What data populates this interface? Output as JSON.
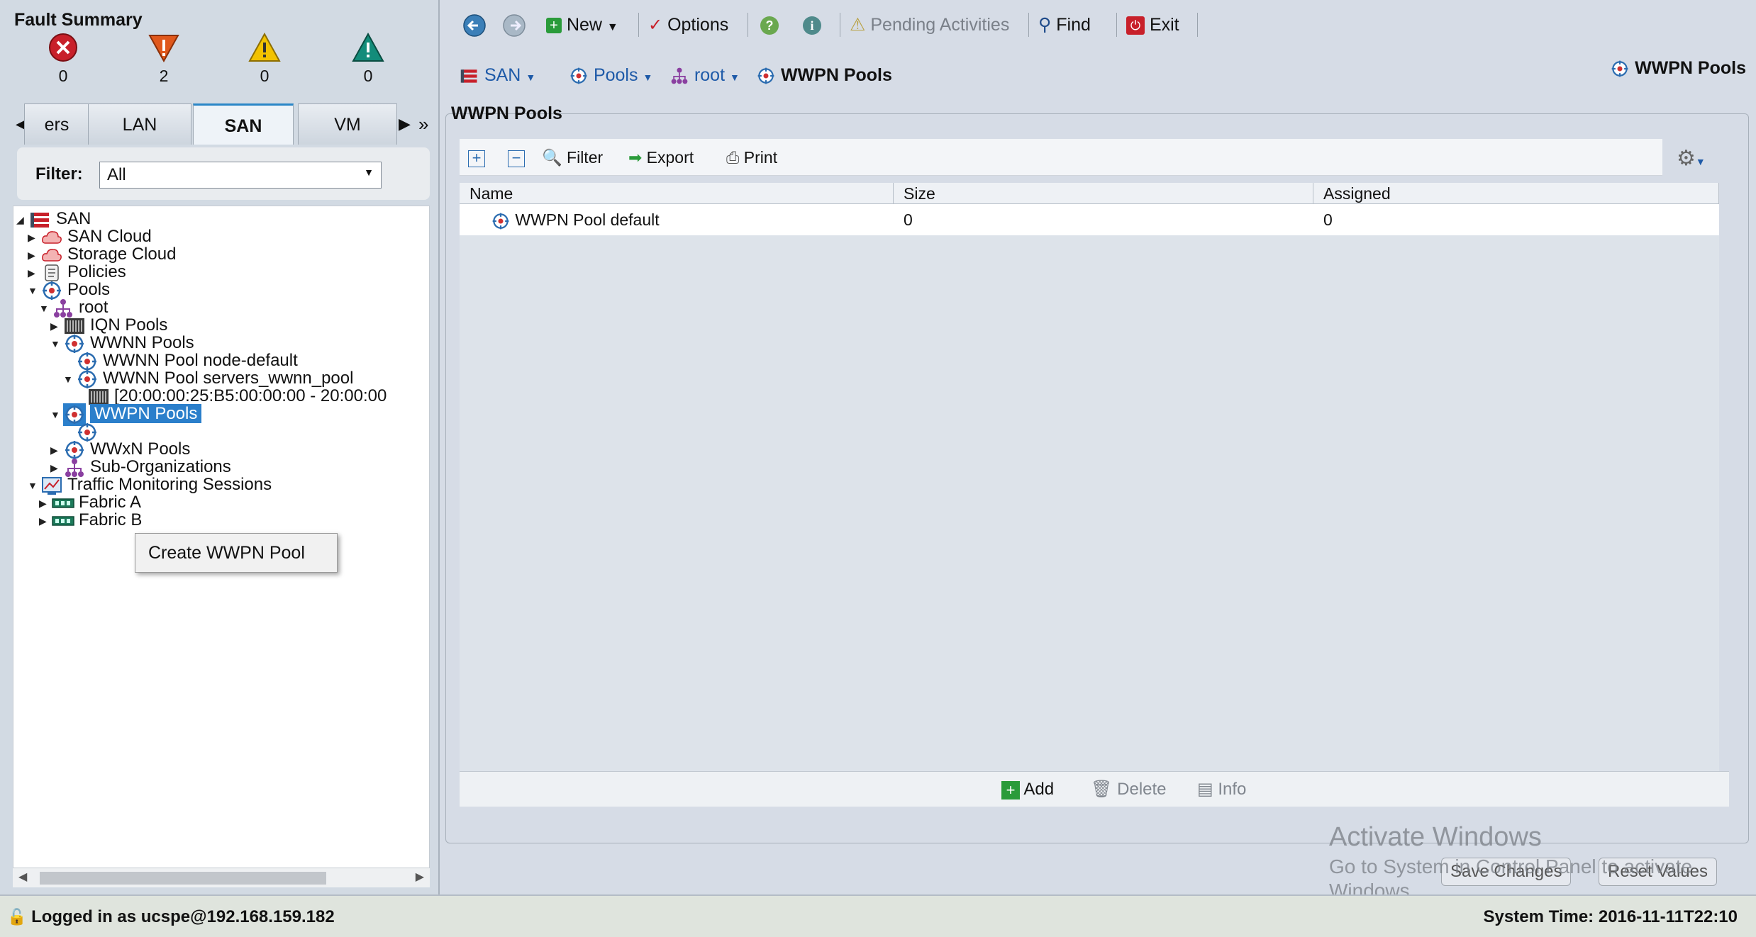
{
  "fault_summary": {
    "title": "Fault Summary",
    "critical": "0",
    "major": "2",
    "minor": "0",
    "warning": "0"
  },
  "nav_tabs": [
    "ers",
    "LAN",
    "SAN",
    "VM"
  ],
  "active_tab": "SAN",
  "filter": {
    "label": "Filter:",
    "value": "All"
  },
  "tree": {
    "san": "SAN",
    "san_cloud": "SAN Cloud",
    "storage_cloud": "Storage Cloud",
    "policies": "Policies",
    "pools": "Pools",
    "root": "root",
    "iqn_pools": "IQN Pools",
    "wwnn_pools": "WWNN Pools",
    "wwnn_node_default": "WWNN Pool node-default",
    "wwnn_servers": "WWNN Pool servers_wwnn_pool",
    "wwnn_block": "[20:00:00:25:B5:00:00:00 - 20:00:00",
    "wwpn_pools": "WWPN Pools",
    "wwxn_pools": "WWxN Pools",
    "sub_orgs": "Sub-Organizations",
    "traffic": "Traffic Monitoring Sessions",
    "fabric_a": "Fabric A",
    "fabric_b": "Fabric B"
  },
  "context_menu": {
    "item": "Create WWPN Pool"
  },
  "toolbar": {
    "new": "New",
    "options": "Options",
    "pending": "Pending Activities",
    "find": "Find",
    "exit": "Exit"
  },
  "breadcrumb": [
    "SAN",
    "Pools",
    "root",
    "WWPN Pools"
  ],
  "header_right": "WWPN Pools",
  "section_title": "WWPN Pools",
  "table_toolbar": {
    "filter": "Filter",
    "export": "Export",
    "print": "Print"
  },
  "table": {
    "columns": [
      "Name",
      "Size",
      "Assigned"
    ],
    "rows": [
      {
        "name": "WWPN Pool default",
        "size": "0",
        "assigned": "0"
      }
    ]
  },
  "bottom_actions": {
    "add": "Add",
    "delete": "Delete",
    "info": "Info"
  },
  "buttons": {
    "save": "Save Changes",
    "reset": "Reset Values"
  },
  "watermark": {
    "line1": "Activate Windows",
    "line2": "Go to System in Control Panel to activate",
    "line3": "Windows."
  },
  "status": {
    "login": "Logged in as ucspe@192.168.159.182",
    "time": "System Time: 2016-11-11T22:10"
  },
  "colors": {
    "accent": "#2b7fcb",
    "critical": "#c8202a",
    "major": "#e0581c",
    "minor": "#f2c200",
    "warning": "#138c7a"
  }
}
